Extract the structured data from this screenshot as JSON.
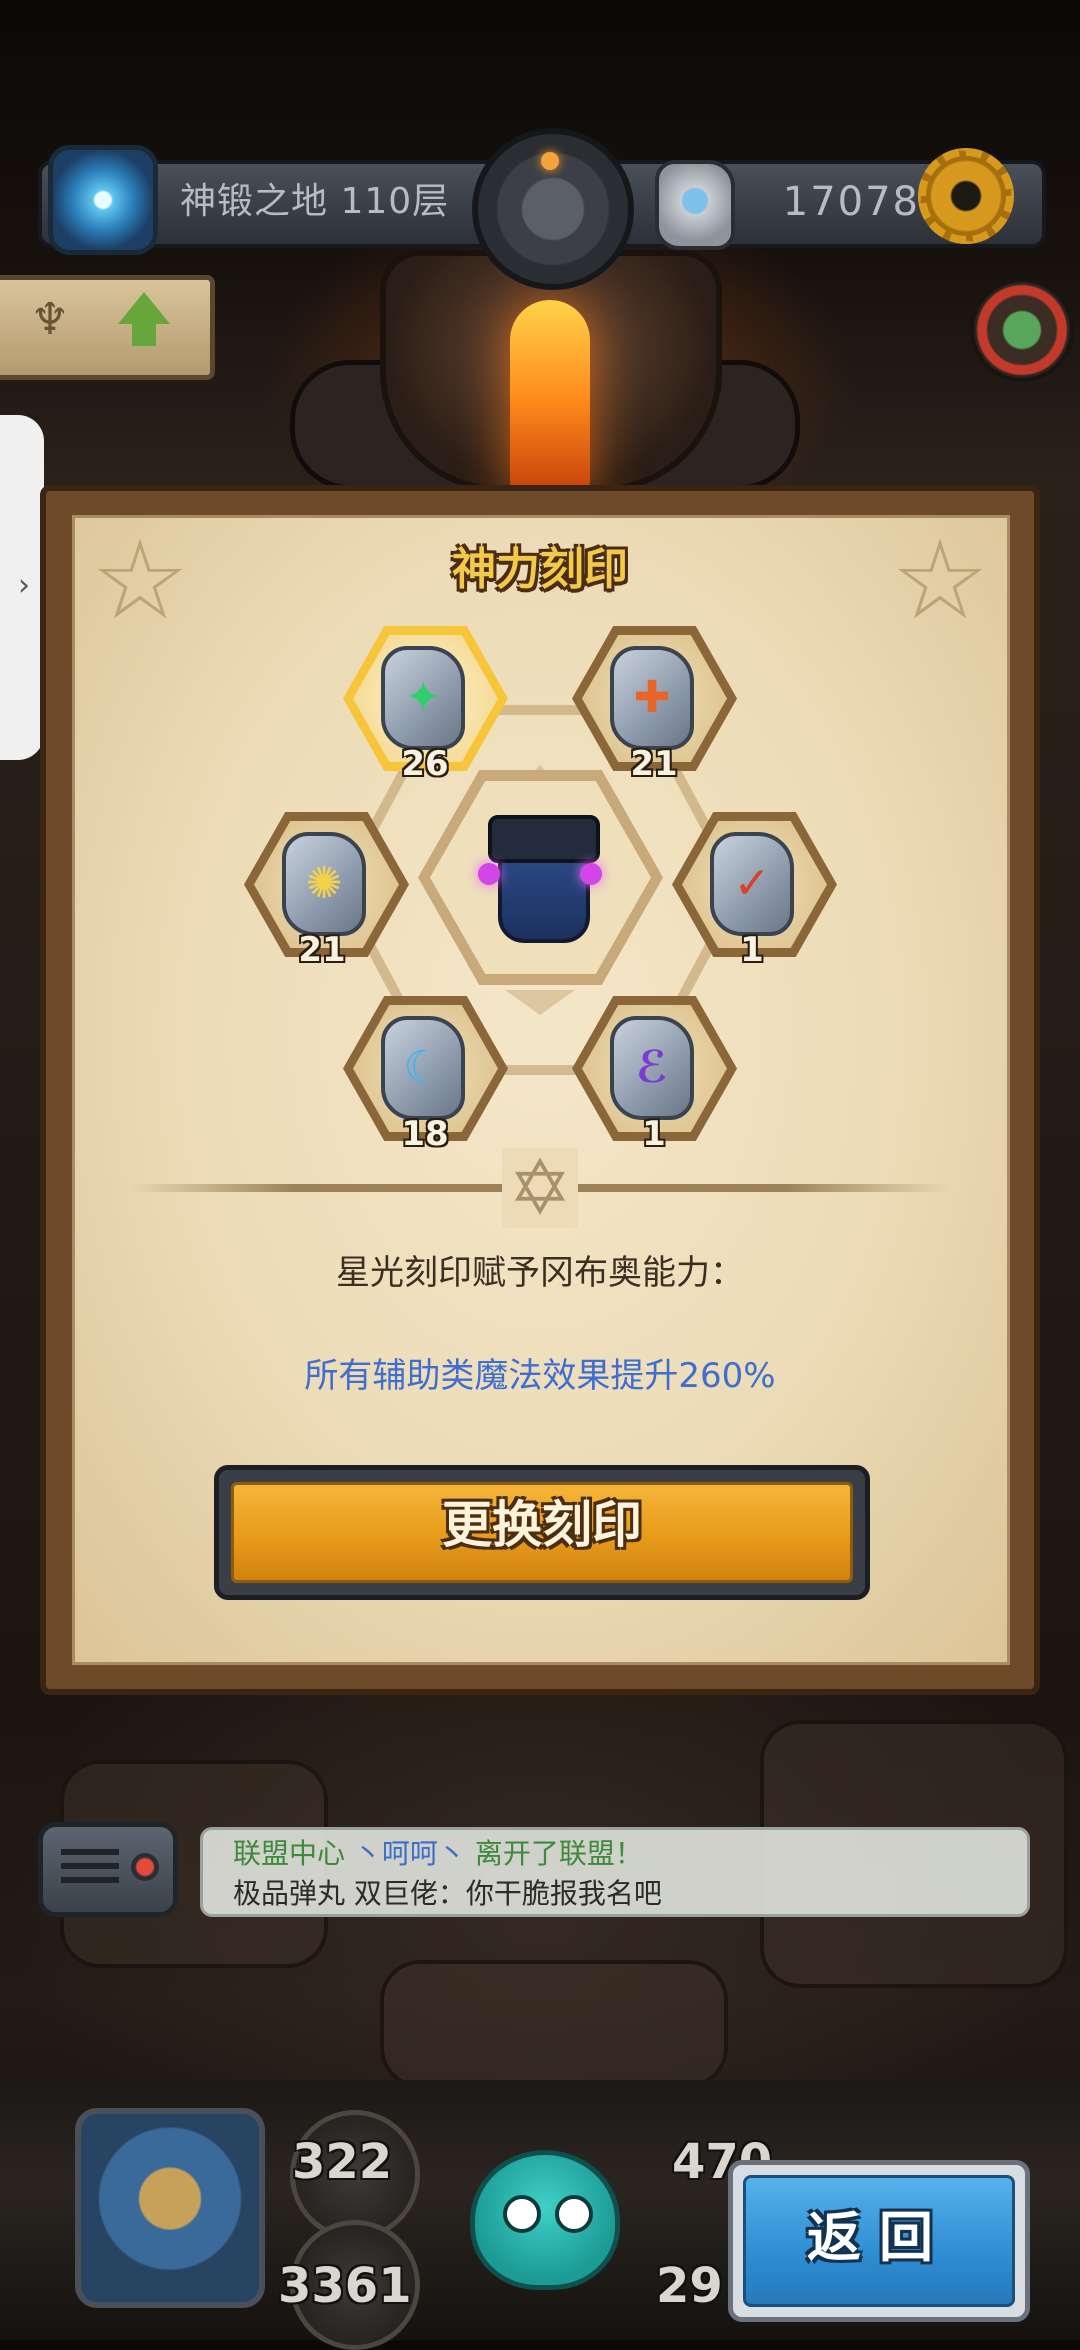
{
  "topbar": {
    "floor_label": "神锻之地 110层",
    "currency_value": "17078"
  },
  "panel": {
    "title": "神力刻印",
    "runes": [
      {
        "name": "star",
        "count": "26",
        "selected": true,
        "color": "#2fcf6b",
        "glyph": "✦"
      },
      {
        "name": "fire",
        "count": "21",
        "selected": false,
        "color": "#e8652a",
        "glyph": "✚"
      },
      {
        "name": "sun",
        "count": "21",
        "selected": false,
        "color": "#f3d24a",
        "glyph": "✺"
      },
      {
        "name": "blood",
        "count": "1",
        "selected": false,
        "color": "#d8412a",
        "glyph": "✓"
      },
      {
        "name": "moon",
        "count": "18",
        "selected": false,
        "color": "#39b8f0",
        "glyph": "☾"
      },
      {
        "name": "shadow",
        "count": "1",
        "selected": false,
        "color": "#7a3bd0",
        "glyph": "ℰ"
      }
    ],
    "effect_title": "星光刻印赋予冈布奥能力：",
    "effect_desc": "所有辅助类魔法效果提升260%",
    "change_button_label": "更换刻印"
  },
  "chat": {
    "line1_channel": "联盟中心",
    "line1_name": "丶呵呵丶",
    "line1_msg": "离开了联盟！",
    "line2_sender": "极品弹丸",
    "line2_text": "双巨佬：你干脆报我名吧"
  },
  "bottom": {
    "stat_top_left": "322",
    "stat_bottom_left": "3361",
    "stat_top_right": "470",
    "stat_bottom_right": "29",
    "back_button_label": "返回"
  },
  "colors": {
    "title_gold": "#f2c94a",
    "effect_blue": "#3f6ed1",
    "button_orange": "#e79b19",
    "button_blue": "#2f8dd3"
  }
}
